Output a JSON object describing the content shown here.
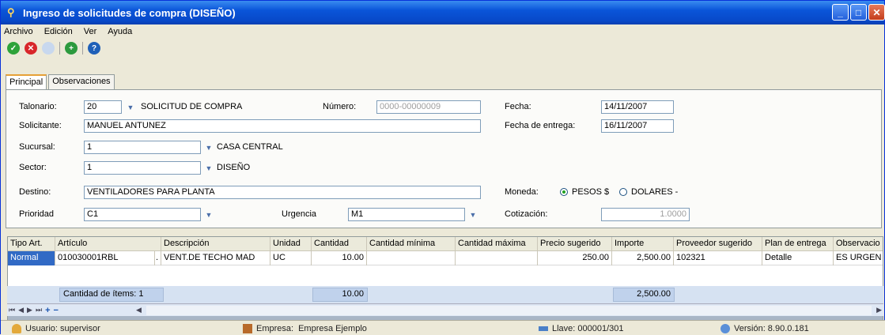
{
  "window": {
    "title": "Ingreso de solicitudes de compra (DISEÑO)"
  },
  "menu": [
    "Archivo",
    "Edición",
    "Ver",
    "Ayuda"
  ],
  "tabs": [
    "Principal",
    "Observaciones"
  ],
  "form": {
    "talonario_label": "Talonario:",
    "talonario_value": "20",
    "talonario_desc": "SOLICITUD DE COMPRA",
    "numero_label": "Número:",
    "numero_value": "0000-00000009",
    "fecha_label": "Fecha:",
    "fecha_value": "14/11/2007",
    "solicitante_label": "Solicitante:",
    "solicitante_value": "MANUEL ANTUNEZ",
    "fecha_entrega_label": "Fecha de entrega:",
    "fecha_entrega_value": "16/11/2007",
    "sucursal_label": "Sucursal:",
    "sucursal_value": "1",
    "sucursal_desc": "CASA CENTRAL",
    "sector_label": "Sector:",
    "sector_value": "1",
    "sector_desc": "DISEÑO",
    "destino_label": "Destino:",
    "destino_value": "VENTILADORES PARA PLANTA",
    "moneda_label": "Moneda:",
    "moneda_opt1": "PESOS $",
    "moneda_opt2": "DOLARES -",
    "prioridad_label": "Prioridad",
    "prioridad_value": "C1",
    "urgencia_label": "Urgencia",
    "urgencia_value": "M1",
    "cotizacion_label": "Cotización:",
    "cotizacion_value": "1.0000"
  },
  "grid": {
    "headers": [
      "Tipo Art.",
      "Artículo",
      "Descripción",
      "Unidad",
      "Cantidad",
      "Cantidad mínima",
      "Cantidad máxima",
      "Precio sugerido",
      "Importe",
      "Proveedor sugerido",
      "Plan de entrega",
      "Observacio"
    ],
    "rows": [
      [
        "Normal",
        "010030001RBL",
        ".",
        "VENT.DE TECHO MAD",
        "UC",
        "10.00",
        "",
        "",
        "250.00",
        "2,500.00",
        "102321",
        "Detalle",
        "ES URGEN"
      ]
    ]
  },
  "totals": {
    "count_label": "Cantidad de ítems: 1",
    "cantidad": "10.00",
    "importe": "2,500.00"
  },
  "status": {
    "usuario": "Usuario: supervisor",
    "empresa_label": "Empresa:",
    "empresa_value": "Empresa Ejemplo",
    "llave": "Llave: 000001/301",
    "version": "Versión: 8.90.0.181"
  }
}
